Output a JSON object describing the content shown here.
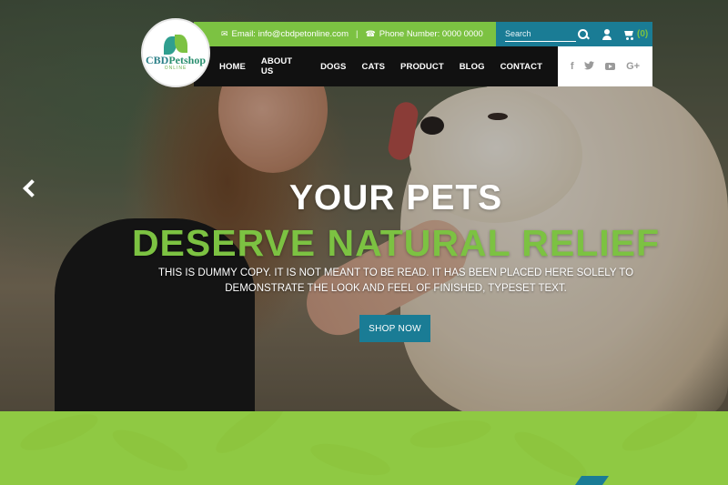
{
  "brand": {
    "logo_line1": "CBD",
    "logo_line2": "Petshop",
    "logo_sub": "ONLINE"
  },
  "topbar": {
    "email_label": "Email: info@cbdpetonline.com",
    "separator": "|",
    "phone_label": "Phone Number: 0000 0000"
  },
  "search": {
    "placeholder": "Search",
    "cart_count": "(0)"
  },
  "nav": {
    "items": [
      "HOME",
      "ABOUT US",
      "DOGS",
      "CATS",
      "PRODUCT",
      "BLOG",
      "CONTACT"
    ]
  },
  "social": {
    "facebook": "f",
    "google": "G+"
  },
  "hero": {
    "headline1": "YOUR PETS",
    "headline2": "DESERVE NATURAL RELIEF",
    "subcopy": "THIS IS DUMMY COPY. IT IS NOT MEANT TO BE READ. IT HAS BEEN PLACED HERE SOLELY TO DEMONSTRATE THE LOOK AND FEEL OF FINISHED, TYPESET TEXT.",
    "cta": "SHOP NOW"
  },
  "colors": {
    "green": "#7cc242",
    "teal": "#1a7c95",
    "dark_nav": "#111111"
  }
}
